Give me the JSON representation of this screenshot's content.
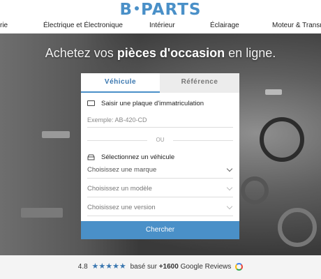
{
  "header": {
    "logo_left": "B",
    "logo_right": "PARTS"
  },
  "nav": {
    "items": [
      "rie",
      "Électrique et Électronique",
      "Intérieur",
      "Éclairage",
      "Moteur & Transmi"
    ]
  },
  "hero": {
    "title_pre": "Achetez vos ",
    "title_bold": "pièces d'occasion",
    "title_post": " en ligne."
  },
  "search": {
    "tabs": [
      "Véhicule",
      "Référence"
    ],
    "plate_label": "Saisir une plaque d'immatriculation",
    "plate_placeholder": "Exemple: AB-420-CD",
    "separator": "OU",
    "vehicle_label": "Sélectionnez un véhicule",
    "brand_select": "Choisissez une marque",
    "model_select": "Choisissez un modèle",
    "version_select": "Choisissez une version",
    "submit_label": "Chercher"
  },
  "reviews": {
    "rating": "4.8",
    "stars": "★★★★★",
    "text_pre": "basé sur ",
    "count": "+1600",
    "text_post": " Google Reviews"
  },
  "colors": {
    "accent": "#4a90c8",
    "tab_inactive": "#ececec"
  }
}
